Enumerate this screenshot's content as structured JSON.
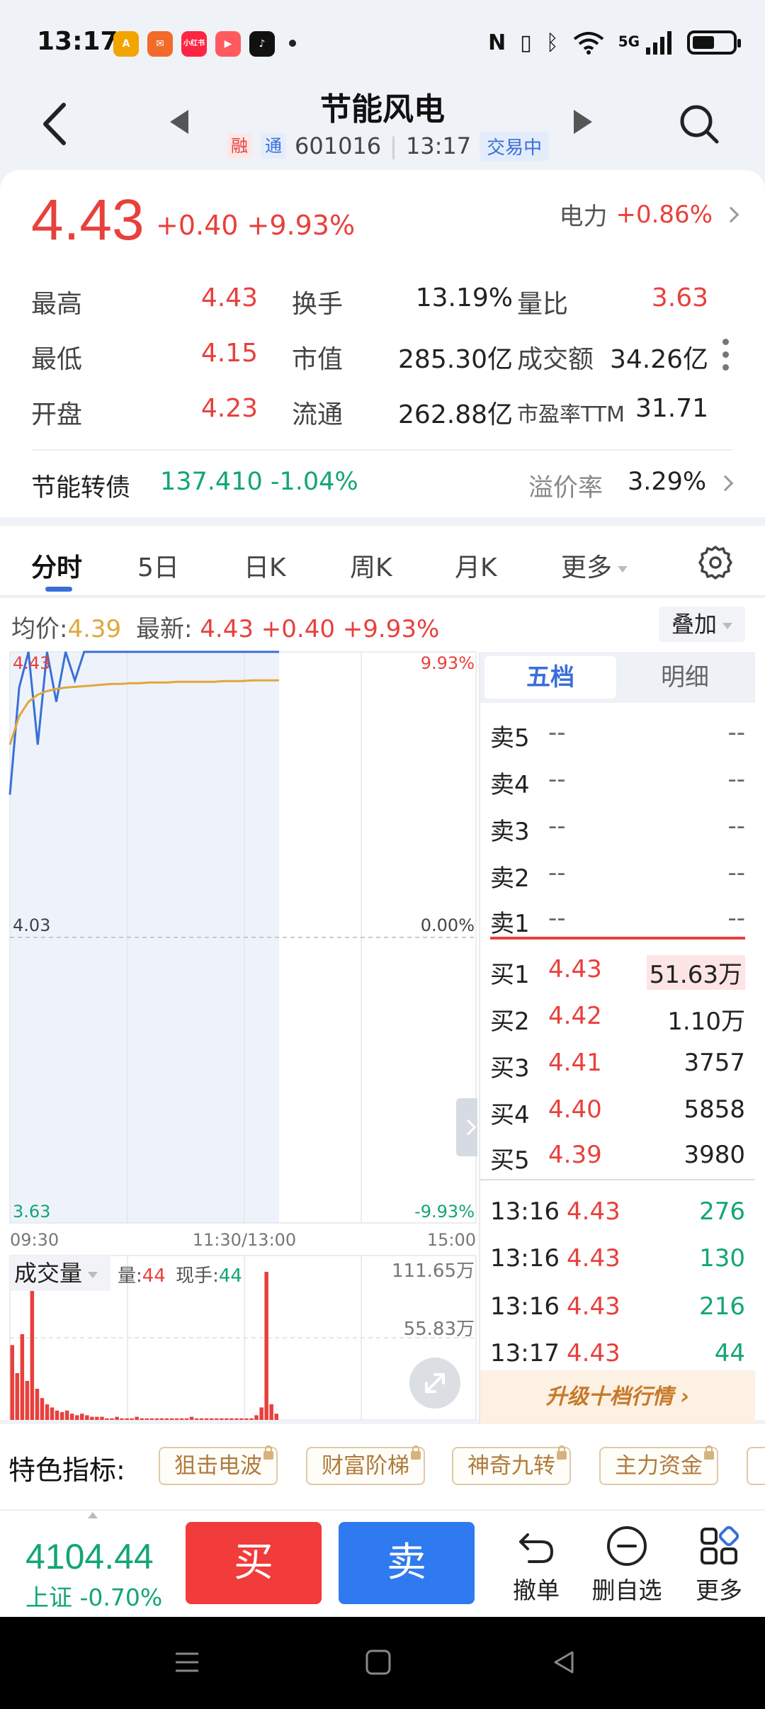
{
  "status_bar": {
    "time": "13:17",
    "network": "5G",
    "apps": [
      {
        "name": "app-icon-1",
        "color": "#f2a500",
        "glyph": "A"
      },
      {
        "name": "app-icon-2",
        "color": "#f26b2a",
        "glyph": "✉"
      },
      {
        "name": "app-icon-3",
        "color": "#ff2442",
        "glyph": "小红书"
      },
      {
        "name": "app-icon-4",
        "color": "#ff5a5f",
        "glyph": "▶"
      },
      {
        "name": "app-icon-5",
        "color": "#111111",
        "glyph": "♪"
      }
    ]
  },
  "header": {
    "stock_name": "节能风电",
    "tag_rong": "融",
    "tag_tong": "通",
    "code": "601016",
    "time": "13:17",
    "trade_status": "交易中"
  },
  "quote": {
    "price": "4.43",
    "change": "+0.40 +9.93%",
    "industry_label": "电力",
    "industry_change": "+0.86%",
    "stats": [
      {
        "l1": "最高",
        "v1": "4.43",
        "l2": "换手",
        "v2": "13.19%",
        "l3": "量比",
        "v3": "3.63"
      },
      {
        "l1": "最低",
        "v1": "4.15",
        "l2": "市值",
        "v2": "285.30亿",
        "l3": "成交额",
        "v3": "34.26亿"
      },
      {
        "l1": "开盘",
        "v1": "4.23",
        "l2": "流通",
        "v2": "262.88亿",
        "l3": "市盈率TTM",
        "v3": "31.71"
      }
    ],
    "bond_label": "节能转债",
    "bond_value": "137.410 -1.04%",
    "premium_label": "溢价率",
    "premium_value": "3.29%"
  },
  "tabs": [
    {
      "label": "分时",
      "active": true
    },
    {
      "label": "5日"
    },
    {
      "label": "日K"
    },
    {
      "label": "周K"
    },
    {
      "label": "月K"
    },
    {
      "label": "更多"
    }
  ],
  "chart_info": {
    "avg_label": "均价:",
    "avg_value": "4.39",
    "latest_label": "最新:",
    "latest_value": "4.43 +0.40 +9.93%",
    "overlay_label": "叠加",
    "volume_label": "成交量",
    "vol_text": "量:",
    "vol_value": "44",
    "hand_text": "现手:",
    "hand_value": "44"
  },
  "chart_data": {
    "type": "line",
    "price_axis": {
      "max": "4.43",
      "mid": "4.03",
      "min": "3.63"
    },
    "pct_axis": {
      "max": "9.93%",
      "mid": "0.00%",
      "min": "-9.93%"
    },
    "ylim": [
      3.63,
      4.43
    ],
    "x_labels": [
      "09:30",
      "11:30/13:00",
      "15:00"
    ],
    "volume_axis": {
      "max": "111.65万",
      "mid": "55.83万"
    },
    "series": [
      {
        "name": "最新",
        "color": "#3a6fd8",
        "values": [
          4.23,
          4.38,
          4.43,
          4.3,
          4.43,
          4.36,
          4.43,
          4.39,
          4.43,
          4.43,
          4.43,
          4.43,
          4.43,
          4.43,
          4.43,
          4.43,
          4.43,
          4.43,
          4.43,
          4.43,
          4.43,
          4.43,
          4.43,
          4.43,
          4.43,
          4.43,
          4.43,
          4.43,
          4.43,
          4.43
        ]
      },
      {
        "name": "均价",
        "color": "#e0a83a",
        "values": [
          4.3,
          4.34,
          4.36,
          4.37,
          4.375,
          4.378,
          4.38,
          4.381,
          4.382,
          4.383,
          4.384,
          4.385,
          4.385,
          4.386,
          4.386,
          4.387,
          4.387,
          4.387,
          4.388,
          4.388,
          4.388,
          4.388,
          4.388,
          4.389,
          4.389,
          4.389,
          4.39,
          4.39,
          4.39,
          4.39
        ]
      }
    ],
    "volume_bars": [
      48,
      30,
      55,
      25,
      88,
      20,
      14,
      10,
      8,
      6,
      5,
      6,
      4,
      3,
      4,
      3,
      2,
      2,
      2,
      1,
      1,
      2,
      1,
      1,
      1,
      2,
      1,
      1,
      1,
      1,
      1,
      1,
      1,
      1,
      1,
      1,
      2,
      1,
      1,
      1,
      1,
      1,
      1,
      1,
      1,
      1,
      1,
      1,
      1,
      3,
      8,
      95,
      10,
      4
    ]
  },
  "orderbook": {
    "tab_five": "五档",
    "tab_detail": "明细",
    "asks": [
      {
        "label": "卖5",
        "price": "--",
        "vol": "--"
      },
      {
        "label": "卖4",
        "price": "--",
        "vol": "--"
      },
      {
        "label": "卖3",
        "price": "--",
        "vol": "--"
      },
      {
        "label": "卖2",
        "price": "--",
        "vol": "--"
      },
      {
        "label": "卖1",
        "price": "--",
        "vol": "--"
      }
    ],
    "bids": [
      {
        "label": "买1",
        "price": "4.43",
        "vol": "51.63万"
      },
      {
        "label": "买2",
        "price": "4.42",
        "vol": "1.10万"
      },
      {
        "label": "买3",
        "price": "4.41",
        "vol": "3757"
      },
      {
        "label": "买4",
        "price": "4.40",
        "vol": "5858"
      },
      {
        "label": "买5",
        "price": "4.39",
        "vol": "3980"
      }
    ],
    "ticks": [
      {
        "time": "13:16",
        "price": "4.43",
        "vol": "276"
      },
      {
        "time": "13:16",
        "price": "4.43",
        "vol": "130"
      },
      {
        "time": "13:16",
        "price": "4.43",
        "vol": "216"
      },
      {
        "time": "13:17",
        "price": "4.43",
        "vol": "44"
      }
    ],
    "upgrade": "升级十档行情 ›"
  },
  "features": {
    "label": "特色指标:",
    "chips": [
      "狙击电波",
      "财富阶梯",
      "神奇九转",
      "主力资金"
    ]
  },
  "bottom": {
    "index_value": "4104.44",
    "index_name": "上证",
    "index_change": "-0.70%",
    "buy": "买",
    "sell": "卖",
    "cancel": "撤单",
    "remove_watch": "删自选",
    "more": "更多"
  }
}
